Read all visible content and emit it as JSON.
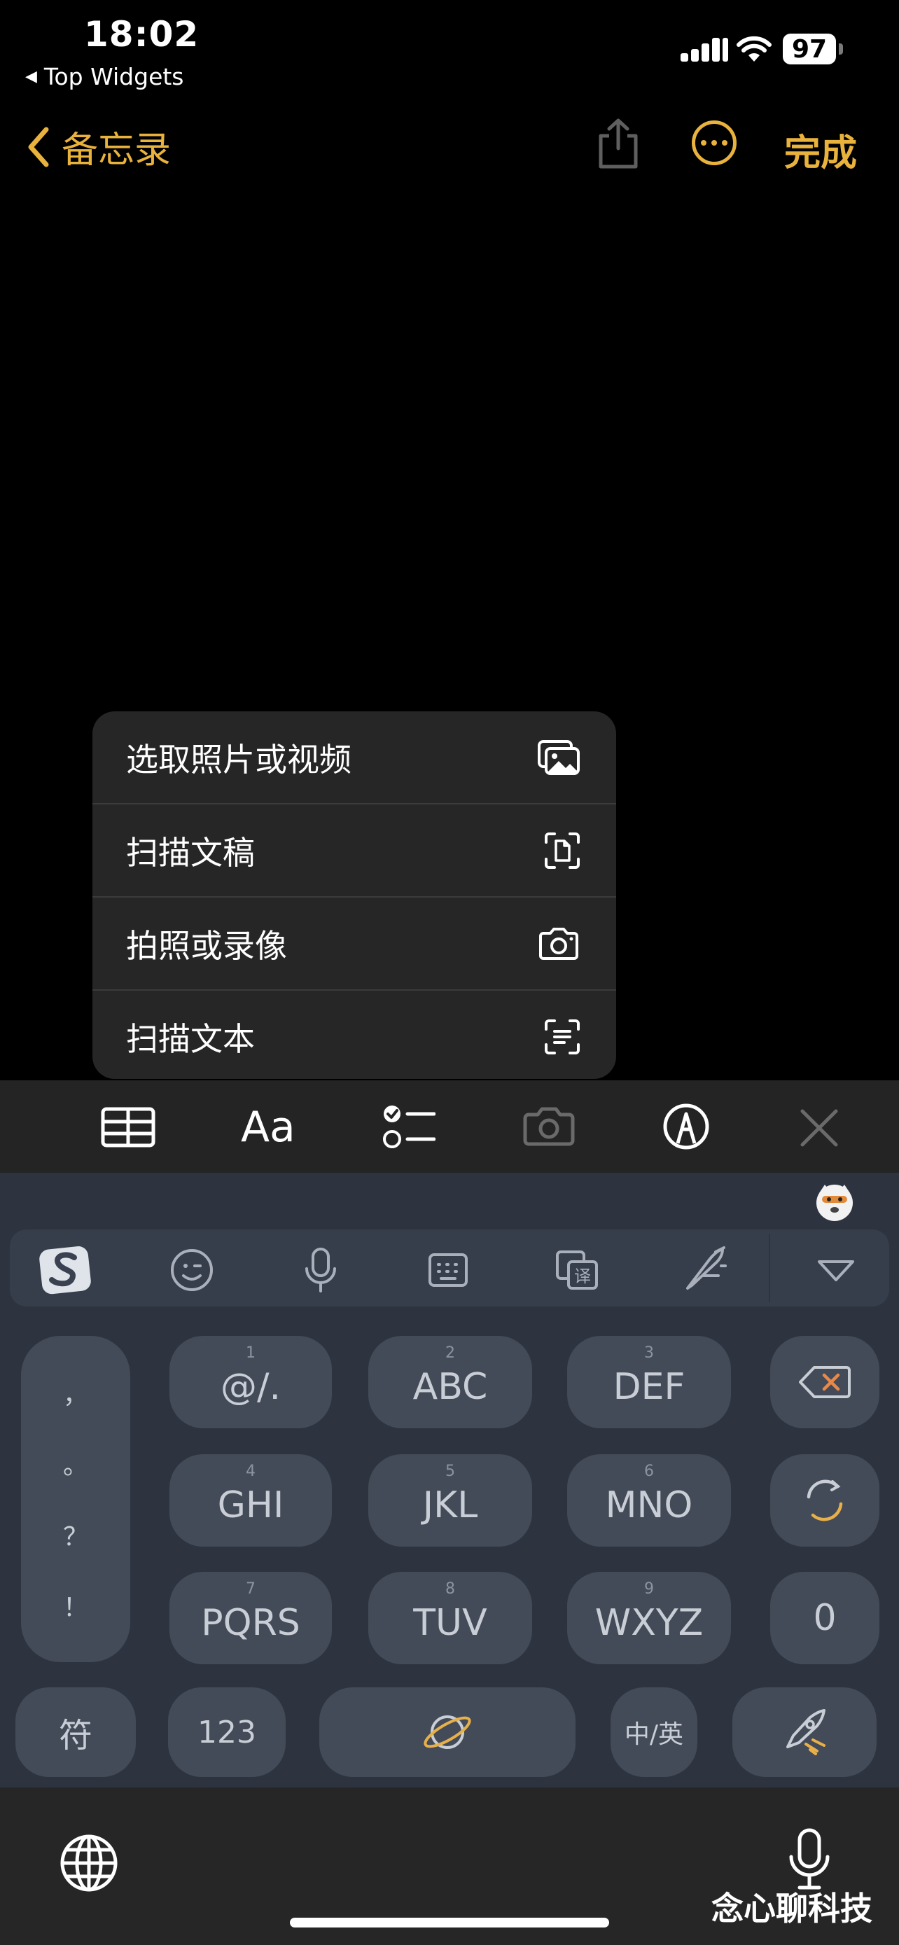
{
  "status_bar": {
    "time": "18:02",
    "back_app": "Top Widgets",
    "battery": "97"
  },
  "nav": {
    "back_label": "备忘录",
    "done_label": "完成",
    "accent_color": "#E9B23C"
  },
  "menu": {
    "items": [
      {
        "label": "选取照片或视频",
        "icon": "photo-library-icon"
      },
      {
        "label": "扫描文稿",
        "icon": "scan-document-icon"
      },
      {
        "label": "拍照或录像",
        "icon": "camera-icon"
      },
      {
        "label": "扫描文本",
        "icon": "scan-text-icon"
      }
    ]
  },
  "toolbar": {
    "format_label": "Aa",
    "icons": [
      "table-icon",
      "format-icon",
      "checklist-icon",
      "camera-icon",
      "markup-pen-icon",
      "close-icon"
    ]
  },
  "keyboard": {
    "suggestion_icons": [
      "sogou-logo-icon",
      "emoji-icon",
      "voice-icon",
      "keyboard-icon",
      "clipboard-icon",
      "translate-icon",
      "handwriting-icon",
      "collapse-icon"
    ],
    "punctuation": [
      "，",
      "。",
      "？",
      "！"
    ],
    "rows": [
      [
        {
          "num": "1",
          "label": "@/."
        },
        {
          "num": "2",
          "label": "ABC"
        },
        {
          "num": "3",
          "label": "DEF"
        }
      ],
      [
        {
          "num": "4",
          "label": "GHI"
        },
        {
          "num": "5",
          "label": "JKL"
        },
        {
          "num": "6",
          "label": "MNO"
        }
      ],
      [
        {
          "num": "7",
          "label": "PQRS"
        },
        {
          "num": "8",
          "label": "TUV"
        },
        {
          "num": "9",
          "label": "WXYZ"
        }
      ]
    ],
    "zero_label": "0",
    "symbol_label": "符",
    "number_label": "123",
    "lang_label": "中/英"
  },
  "watermark": "念心聊科技"
}
